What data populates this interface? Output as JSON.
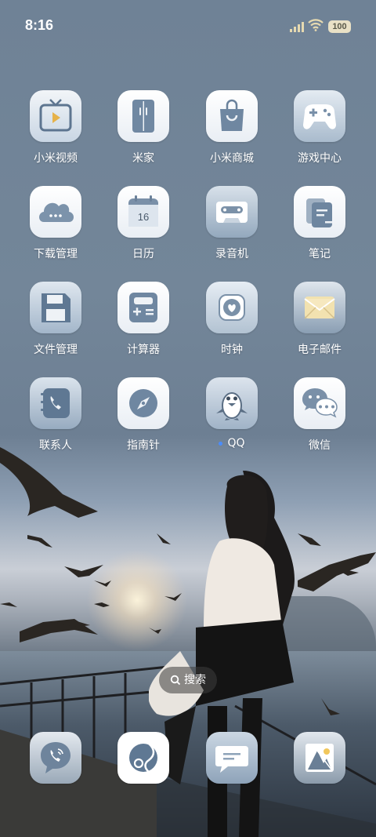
{
  "status": {
    "time": "8:16",
    "battery": "100"
  },
  "apps": [
    {
      "label": "小米视频",
      "icon": "tv-icon"
    },
    {
      "label": "米家",
      "icon": "fridge-icon"
    },
    {
      "label": "小米商城",
      "icon": "shopping-bag-icon"
    },
    {
      "label": "游戏中心",
      "icon": "gamepad-icon"
    },
    {
      "label": "下载管理",
      "icon": "cloud-icon"
    },
    {
      "label": "日历",
      "icon": "calendar-icon",
      "day": "16"
    },
    {
      "label": "录音机",
      "icon": "cassette-icon"
    },
    {
      "label": "笔记",
      "icon": "notes-icon"
    },
    {
      "label": "文件管理",
      "icon": "floppy-icon"
    },
    {
      "label": "计算器",
      "icon": "calculator-icon"
    },
    {
      "label": "时钟",
      "icon": "clock-icon"
    },
    {
      "label": "电子邮件",
      "icon": "mail-icon"
    },
    {
      "label": "联系人",
      "icon": "contacts-icon"
    },
    {
      "label": "指南针",
      "icon": "compass-icon"
    },
    {
      "label": "QQ",
      "icon": "qq-penguin-icon",
      "new_dot": true
    },
    {
      "label": "微信",
      "icon": "wechat-icon"
    }
  ],
  "search": {
    "label": "搜索"
  },
  "dock": [
    {
      "icon": "phone-icon"
    },
    {
      "icon": "browser-icon"
    },
    {
      "icon": "messages-icon"
    },
    {
      "icon": "gallery-icon"
    }
  ],
  "colors": {
    "icon_glyph": "#6e86a0",
    "icon_glyph_dark": "#58708a",
    "notification_dot": "#4a8cff"
  }
}
